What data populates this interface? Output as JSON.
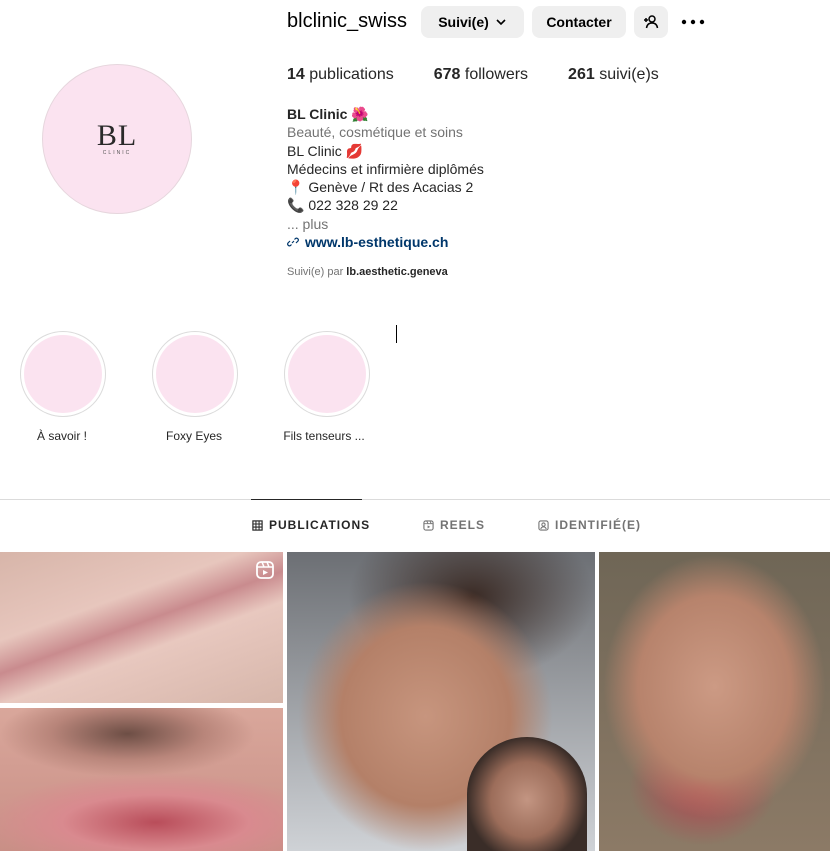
{
  "profile": {
    "username": "blclinic_swiss",
    "avatar_logo": "BL",
    "avatar_sub": "CLINIC"
  },
  "actions": {
    "follow_label": "Suivi(e)",
    "contact_label": "Contacter"
  },
  "stats": {
    "posts_count": "14",
    "posts_label": "publications",
    "followers_count": "678",
    "followers_label": "followers",
    "following_count": "261",
    "following_label": "suivi(e)s"
  },
  "bio": {
    "name": "BL Clinic",
    "name_emoji": "🌺",
    "category": "Beauté, cosmétique et soins",
    "line1": "BL Clinic 💋",
    "line2": "Médecins et infirmière diplômés",
    "location_emoji": "📍",
    "location": " Genève / Rt des Acacias 2",
    "phone_emoji": "📞",
    "phone": " 022 328 29 22",
    "more": "... plus",
    "link": "www.lb-esthetique.ch"
  },
  "followed_by": {
    "prefix": "Suivi(e) par ",
    "user": "lb.aesthetic.geneva"
  },
  "highlights": [
    {
      "label": "À savoir !"
    },
    {
      "label": "Foxy Eyes"
    },
    {
      "label": "Fils tenseurs ..."
    }
  ],
  "tabs": [
    {
      "label": "PUBLICATIONS",
      "active": true
    },
    {
      "label": "REELS",
      "active": false
    },
    {
      "label": "IDENTIFIÉ(E)",
      "active": false
    }
  ],
  "colors": {
    "accent_link": "#00376b",
    "button_bg": "#efefef",
    "avatar_bg": "#fbe3f0"
  }
}
